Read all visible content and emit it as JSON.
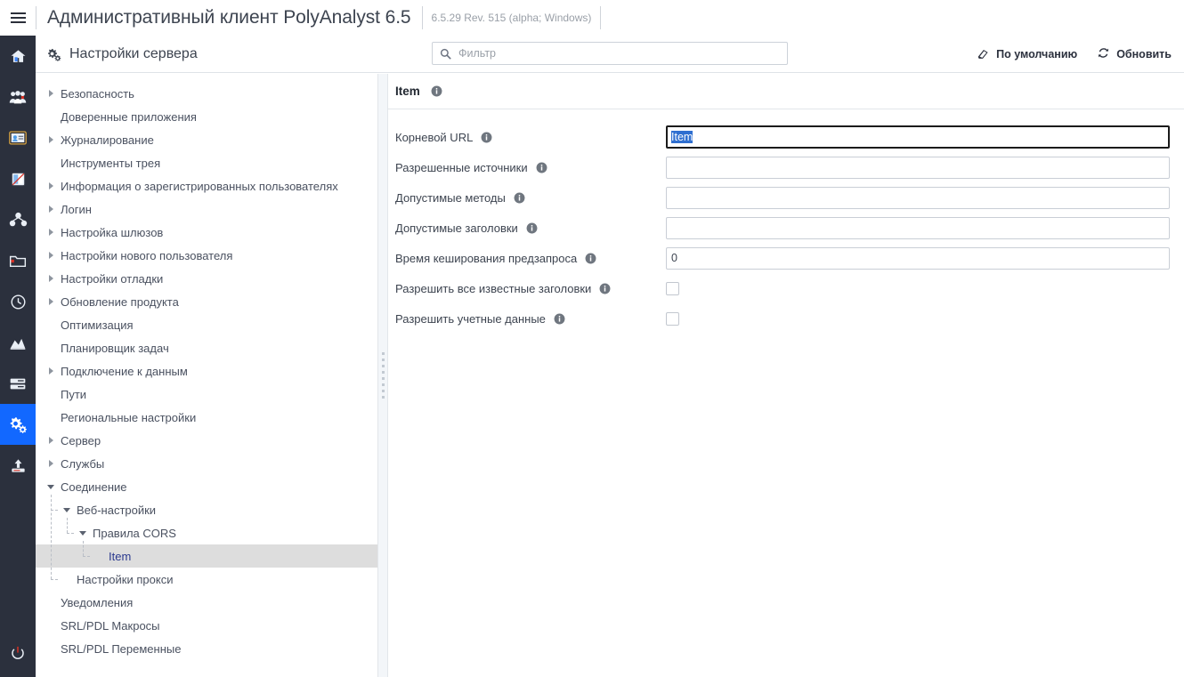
{
  "titlebar": {
    "menu_icon": "hamburger-icon",
    "app_title": "Административный клиент PolyAnalyst 6.5",
    "version": "6.5.29 Rev. 515 (alpha; Windows)"
  },
  "rail": {
    "items": [
      {
        "icon": "home-icon",
        "name": "home",
        "active": false
      },
      {
        "icon": "users-icon",
        "name": "users",
        "active": false
      },
      {
        "icon": "id-card-icon",
        "name": "licenses",
        "active": false
      },
      {
        "icon": "document-icon",
        "name": "documents",
        "active": false
      },
      {
        "icon": "nodes-icon",
        "name": "nodes",
        "active": false
      },
      {
        "icon": "folder-icon",
        "name": "folders",
        "active": false
      },
      {
        "icon": "clock-icon",
        "name": "history",
        "active": false
      },
      {
        "icon": "chart-icon",
        "name": "statistics",
        "active": false
      },
      {
        "icon": "server-icon",
        "name": "server",
        "active": false
      },
      {
        "icon": "gears-icon",
        "name": "server-settings",
        "active": true
      },
      {
        "icon": "upload-icon",
        "name": "upload",
        "active": false
      }
    ],
    "bottom": {
      "icon": "power-icon",
      "name": "power-off"
    }
  },
  "pageheader": {
    "icon": "gears-icon",
    "title": "Настройки сервера",
    "filter": {
      "placeholder": "Фильтр",
      "value": "",
      "icon": "search-icon"
    },
    "actions": [
      {
        "icon": "eraser-icon",
        "label": "По умолчанию",
        "name": "defaults-button"
      },
      {
        "icon": "refresh-icon",
        "label": "Обновить",
        "name": "refresh-button"
      }
    ]
  },
  "tree": {
    "nodes": [
      {
        "label": "Безопасность",
        "indent": 0,
        "toggle": "right",
        "selected": false
      },
      {
        "label": "Доверенные приложения",
        "indent": 0,
        "toggle": "none",
        "selected": false
      },
      {
        "label": "Журналирование",
        "indent": 0,
        "toggle": "right",
        "selected": false
      },
      {
        "label": "Инструменты трея",
        "indent": 0,
        "toggle": "none",
        "selected": false
      },
      {
        "label": "Информация о зарегистрированных пользователях",
        "indent": 0,
        "toggle": "right",
        "selected": false
      },
      {
        "label": "Логин",
        "indent": 0,
        "toggle": "right",
        "selected": false
      },
      {
        "label": "Настройка шлюзов",
        "indent": 0,
        "toggle": "right",
        "selected": false
      },
      {
        "label": "Настройки нового пользователя",
        "indent": 0,
        "toggle": "right",
        "selected": false
      },
      {
        "label": "Настройки отладки",
        "indent": 0,
        "toggle": "right",
        "selected": false
      },
      {
        "label": "Обновление продукта",
        "indent": 0,
        "toggle": "right",
        "selected": false
      },
      {
        "label": "Оптимизация",
        "indent": 0,
        "toggle": "none",
        "selected": false
      },
      {
        "label": "Планировщик задач",
        "indent": 0,
        "toggle": "none",
        "selected": false
      },
      {
        "label": "Подключение к данным",
        "indent": 0,
        "toggle": "right",
        "selected": false
      },
      {
        "label": "Пути",
        "indent": 0,
        "toggle": "none",
        "selected": false
      },
      {
        "label": "Региональные настройки",
        "indent": 0,
        "toggle": "none",
        "selected": false
      },
      {
        "label": "Сервер",
        "indent": 0,
        "toggle": "right",
        "selected": false
      },
      {
        "label": "Службы",
        "indent": 0,
        "toggle": "right",
        "selected": false
      },
      {
        "label": "Соединение",
        "indent": 0,
        "toggle": "down",
        "selected": false
      },
      {
        "label": "Веб-настройки",
        "indent": 1,
        "toggle": "down",
        "selected": false
      },
      {
        "label": "Правила CORS",
        "indent": 2,
        "toggle": "down",
        "selected": false
      },
      {
        "label": "Item",
        "indent": 3,
        "toggle": "none",
        "selected": true
      },
      {
        "label": "Настройки прокси",
        "indent": 1,
        "toggle": "none",
        "selected": false
      },
      {
        "label": "Уведомления",
        "indent": 0,
        "toggle": "none",
        "selected": false
      },
      {
        "label": "SRL/PDL Макросы",
        "indent": 0,
        "toggle": "none",
        "selected": false
      },
      {
        "label": "SRL/PDL Переменные",
        "indent": 0,
        "toggle": "none",
        "selected": false
      }
    ]
  },
  "content": {
    "header_title": "Item",
    "header_info_icon": "info-icon",
    "fields": [
      {
        "label": "Корневой URL",
        "type": "text",
        "value": "Item",
        "focused": true,
        "selected": true,
        "name": "root-url"
      },
      {
        "label": "Разрешенные источники",
        "type": "text",
        "value": "",
        "focused": false,
        "selected": false,
        "name": "allowed-origins"
      },
      {
        "label": "Допустимые методы",
        "type": "text",
        "value": "",
        "focused": false,
        "selected": false,
        "name": "allowed-methods"
      },
      {
        "label": "Допустимые заголовки",
        "type": "text",
        "value": "",
        "focused": false,
        "selected": false,
        "name": "allowed-headers"
      },
      {
        "label": "Время кеширования предзапроса",
        "type": "text",
        "value": "0",
        "focused": false,
        "selected": false,
        "name": "preflight-max-age"
      },
      {
        "label": "Разрешить все известные заголовки",
        "type": "checkbox",
        "checked": false,
        "name": "allow-all-known-headers"
      },
      {
        "label": "Разрешить учетные данные",
        "type": "checkbox",
        "checked": false,
        "name": "allow-credentials"
      }
    ]
  },
  "colors": {
    "rail_bg": "#2b303d",
    "rail_active": "#1268ff",
    "tree_selected_bg": "#dddddd",
    "tree_selected_text": "#2b3a8f",
    "text_selection": "#2f6fd0",
    "border": "#e2e6ea"
  }
}
